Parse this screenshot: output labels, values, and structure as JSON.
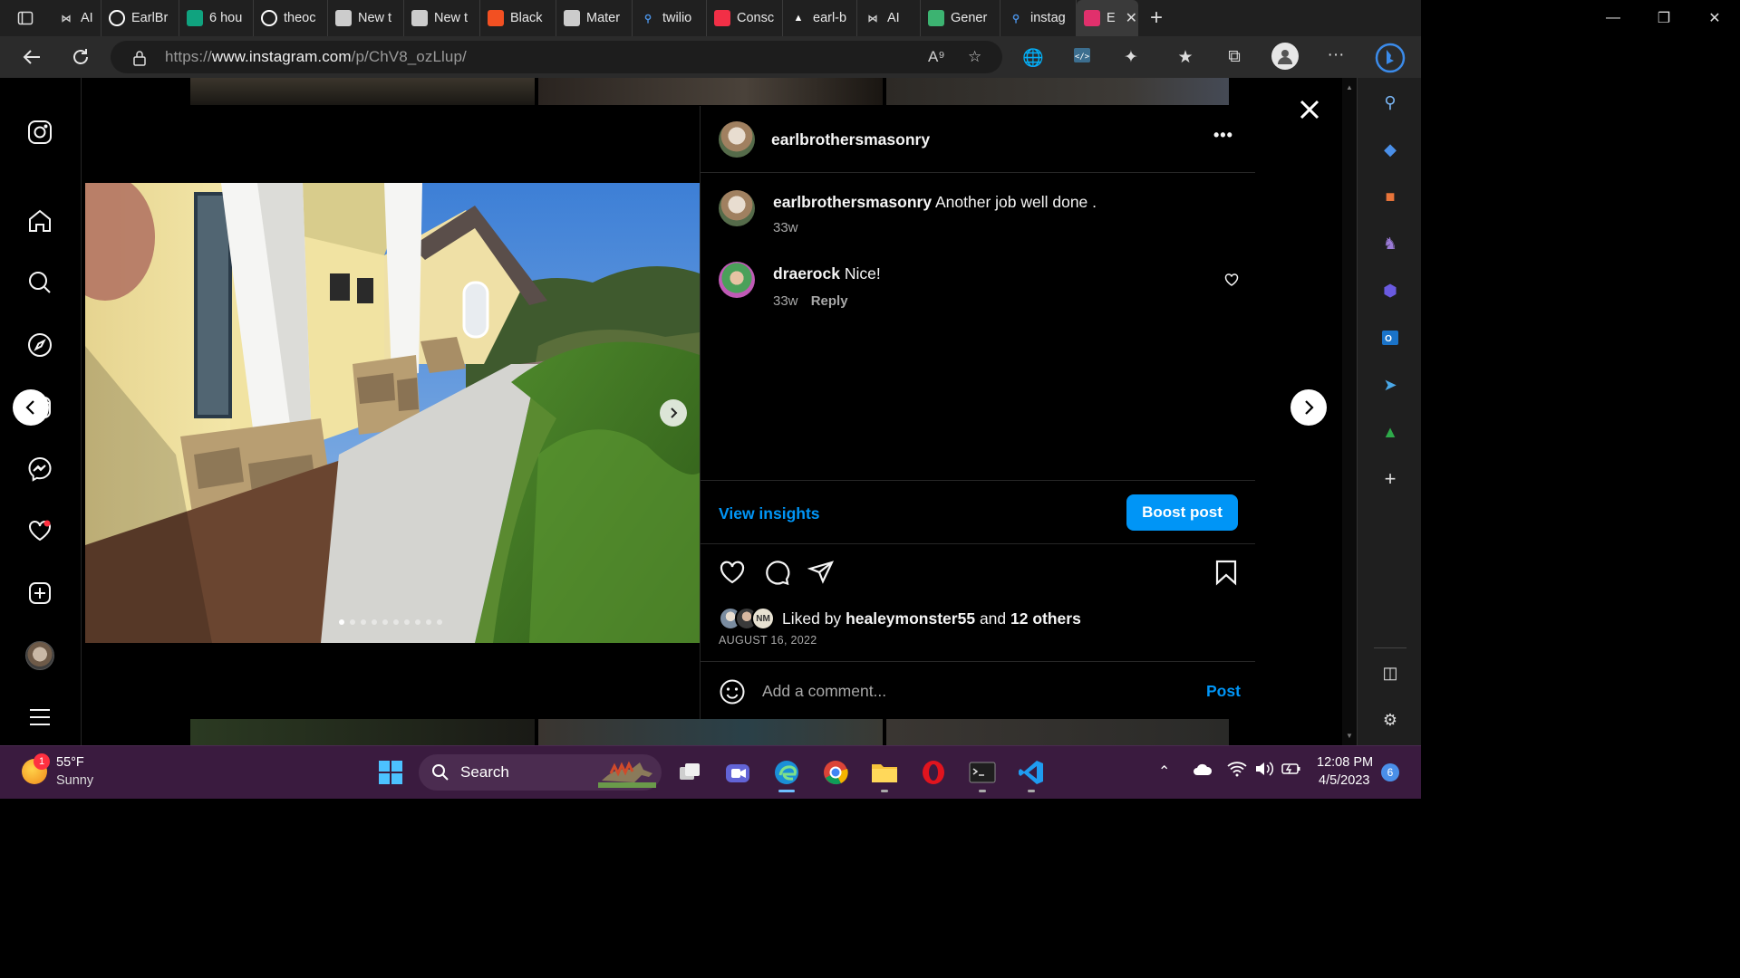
{
  "browser": {
    "tabs": [
      {
        "label": "AI",
        "icon": "bowtie-icon",
        "color": "#cccccc"
      },
      {
        "label": "EarlBr",
        "icon": "github-icon",
        "color": "#ffffff"
      },
      {
        "label": "6 hou",
        "icon": "openai-icon",
        "color": "#10a37f"
      },
      {
        "label": "theoc",
        "icon": "github-icon",
        "color": "#ffffff"
      },
      {
        "label": "New t",
        "icon": "newtab-icon",
        "color": "#cccccc"
      },
      {
        "label": "New t",
        "icon": "newtab-icon",
        "color": "#cccccc"
      },
      {
        "label": "Black",
        "icon": "microsoft-icon",
        "color": "#f25022"
      },
      {
        "label": "Mater",
        "icon": "material-icon",
        "color": "#cccccc"
      },
      {
        "label": "twilio",
        "icon": "search-icon",
        "color": "#4a90e2"
      },
      {
        "label": "Consc",
        "icon": "twilio-icon",
        "color": "#f22f46"
      },
      {
        "label": "earl-b",
        "icon": "vercel-icon",
        "color": "#ffffff"
      },
      {
        "label": "AI",
        "icon": "bowtie-icon",
        "color": "#cccccc"
      },
      {
        "label": "Gener",
        "icon": "qr-icon",
        "color": "#3cb371"
      },
      {
        "label": "instag",
        "icon": "search-icon",
        "color": "#4a90e2"
      },
      {
        "label": "E",
        "icon": "instagram-icon",
        "color": "#e1306c",
        "active": true
      }
    ],
    "url_prefix": "https://",
    "url_host": "www.instagram.com",
    "url_path": "/p/ChV8_ozLlup/"
  },
  "post": {
    "author": "earlbrothersmasonry",
    "more_label": "•••",
    "caption_user": "earlbrothersmasonry",
    "caption_text": "Another job well done .",
    "caption_age": "33w",
    "comment_user": "draerock",
    "comment_text": "Nice!",
    "comment_age": "33w",
    "reply_label": "Reply",
    "insights_label": "View insights",
    "boost_label": "Boost post",
    "liked_prefix": "Liked by",
    "liked_user": "healeymonster55",
    "liked_and": "and",
    "liked_others": "12 others",
    "date": "AUGUST 16, 2022",
    "comment_placeholder": "Add a comment...",
    "post_label": "Post",
    "avatar_initials": "NM",
    "image_index": 1,
    "image_count": 10
  },
  "taskbar": {
    "weather_temp": "55°F",
    "weather_desc": "Sunny",
    "weather_badge": "1",
    "search_label": "Search",
    "time": "12:08 PM",
    "date": "4/5/2023",
    "notification_count": "6"
  },
  "colors": {
    "accent_blue": "#0095f6",
    "taskbar": "#3a1b3f",
    "notification_red": "#ff3040"
  }
}
